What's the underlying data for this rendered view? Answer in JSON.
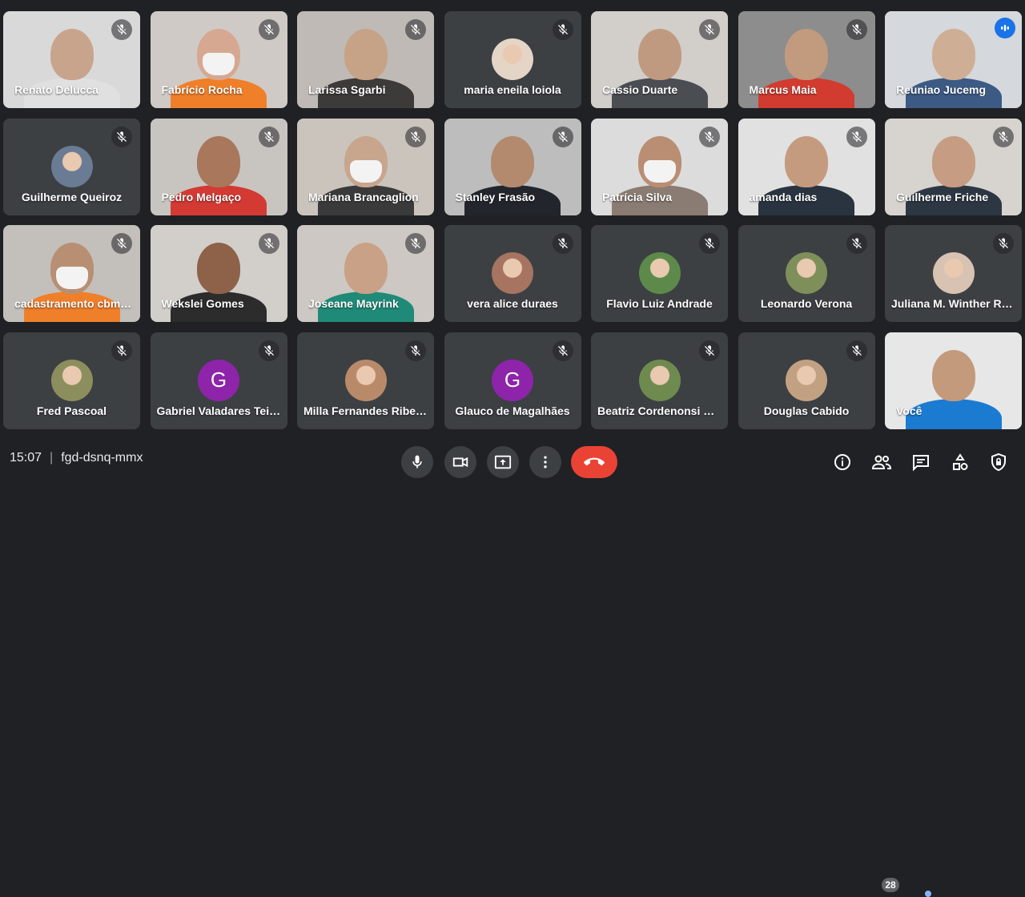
{
  "participants": [
    {
      "name": "Renato Delucca",
      "type": "video",
      "mic": "off",
      "bg": "#d9d9d9",
      "skin": "#c9a48c",
      "shirt": "#e0e0e0"
    },
    {
      "name": "Fabrício Rocha",
      "type": "video",
      "mic": "off",
      "bg": "#cfcac6",
      "skin": "#d6a891",
      "shirt": "#f07f2a",
      "mask": true
    },
    {
      "name": "Larissa Sgarbi",
      "type": "video",
      "mic": "off",
      "bg": "#bfbab5",
      "skin": "#c6a287",
      "shirt": "#3d3a3a"
    },
    {
      "name": "maria eneila loiola",
      "type": "avatar",
      "mic": "off",
      "avatar_color": "#e4d5c7"
    },
    {
      "name": "Cassio Duarte",
      "type": "video",
      "mic": "off",
      "bg": "#d2cfcb",
      "skin": "#c09a80",
      "shirt": "#4a4d52"
    },
    {
      "name": "Marcus Maia",
      "type": "video",
      "mic": "off",
      "bg": "#8d8d8d",
      "skin": "#c29a7e",
      "shirt": "#d23b2f"
    },
    {
      "name": "Reuniao Jucemg",
      "type": "video",
      "mic": "speaking",
      "bg": "#d5d8dc",
      "skin": "#cfae96",
      "shirt": "#3c5a84"
    },
    {
      "name": "Guilherme Queiroz",
      "type": "avatar",
      "mic": "off",
      "avatar_color": "#6a7b94"
    },
    {
      "name": "Pedro Melgaço",
      "type": "video",
      "mic": "off",
      "bg": "#c8c4c0",
      "skin": "#a8775c",
      "shirt": "#d33a33"
    },
    {
      "name": "Mariana Brancaglion",
      "type": "video",
      "mic": "off",
      "bg": "#cac4bc",
      "skin": "#c8a58d",
      "shirt": "#3a3a3a",
      "mask": true
    },
    {
      "name": "Stanley Frasão",
      "type": "video",
      "mic": "off",
      "bg": "#bdbdbd",
      "skin": "#b38a6e",
      "shirt": "#22262c"
    },
    {
      "name": "Patrícia Silva",
      "type": "video",
      "mic": "off",
      "bg": "#dcdcdc",
      "skin": "#b98e72",
      "shirt": "#8a7c72",
      "mask": true
    },
    {
      "name": "amanda dias",
      "type": "video",
      "mic": "off",
      "bg": "#e1e1e1",
      "skin": "#c59b80",
      "shirt": "#2a3440"
    },
    {
      "name": "Guilherme Friche",
      "type": "video",
      "mic": "off",
      "bg": "#d7d3cf",
      "skin": "#c69d82",
      "shirt": "#2d3743"
    },
    {
      "name": "cadastramento cbmmg",
      "type": "video",
      "mic": "off",
      "bg": "#c3bfbb",
      "skin": "#b88f73",
      "shirt": "#f07f2a",
      "mask": true
    },
    {
      "name": "Wekslei Gomes",
      "type": "video",
      "mic": "off",
      "bg": "#d2cfcb",
      "skin": "#8e6248",
      "shirt": "#2c2c2c"
    },
    {
      "name": "Joseane Mayrink",
      "type": "video",
      "mic": "off",
      "bg": "#cdc8c3",
      "skin": "#c9a186",
      "shirt": "#1f8a78"
    },
    {
      "name": "vera alice duraes",
      "type": "avatar",
      "mic": "off",
      "avatar_color": "#a67460"
    },
    {
      "name": "Flavio Luiz Andrade",
      "type": "avatar",
      "mic": "off",
      "avatar_color": "#5d8a4a"
    },
    {
      "name": "Leonardo Verona",
      "type": "avatar",
      "mic": "off",
      "avatar_color": "#7e8f5a"
    },
    {
      "name": "Juliana M. Winther Rebello",
      "type": "avatar",
      "mic": "off",
      "avatar_color": "#d8c2b2"
    },
    {
      "name": "Fred Pascoal",
      "type": "avatar",
      "mic": "off",
      "avatar_color": "#8c8f5d"
    },
    {
      "name": "Gabriel Valadares Teixeira",
      "type": "letter",
      "mic": "off",
      "letter": "G"
    },
    {
      "name": "Milla Fernandes Ribeiro",
      "type": "avatar",
      "mic": "off",
      "avatar_color": "#b98a6a"
    },
    {
      "name": "Glauco de Magalhães",
      "type": "letter",
      "mic": "off",
      "letter": "G"
    },
    {
      "name": "Beatriz Cordenonsi Barbosa",
      "type": "avatar",
      "mic": "off",
      "avatar_color": "#6f8a4f"
    },
    {
      "name": "Douglas Cabido",
      "type": "avatar",
      "mic": "off",
      "avatar_color": "#c2a182"
    },
    {
      "name": "Você",
      "type": "video",
      "mic": "none",
      "bg": "#e7e7e7",
      "skin": "#c49a7c",
      "shirt": "#1b7bd1"
    }
  ],
  "meeting": {
    "time": "15:07",
    "code": "fgd-dsnq-mmx",
    "participant_count": "28"
  },
  "icons": {
    "mic": "mic-icon",
    "camera": "camera-icon",
    "present": "present-screen-icon",
    "more": "more-vert-icon",
    "hangup": "call-end-icon",
    "info": "info-icon",
    "people": "people-icon",
    "chat": "chat-icon",
    "activities": "activities-icon",
    "host": "host-controls-icon"
  },
  "colors": {
    "background": "#202124",
    "tile": "#3c4043",
    "hangup": "#ea4335",
    "speaking": "#1a73e8",
    "letter_avatar": "#8e24aa"
  }
}
